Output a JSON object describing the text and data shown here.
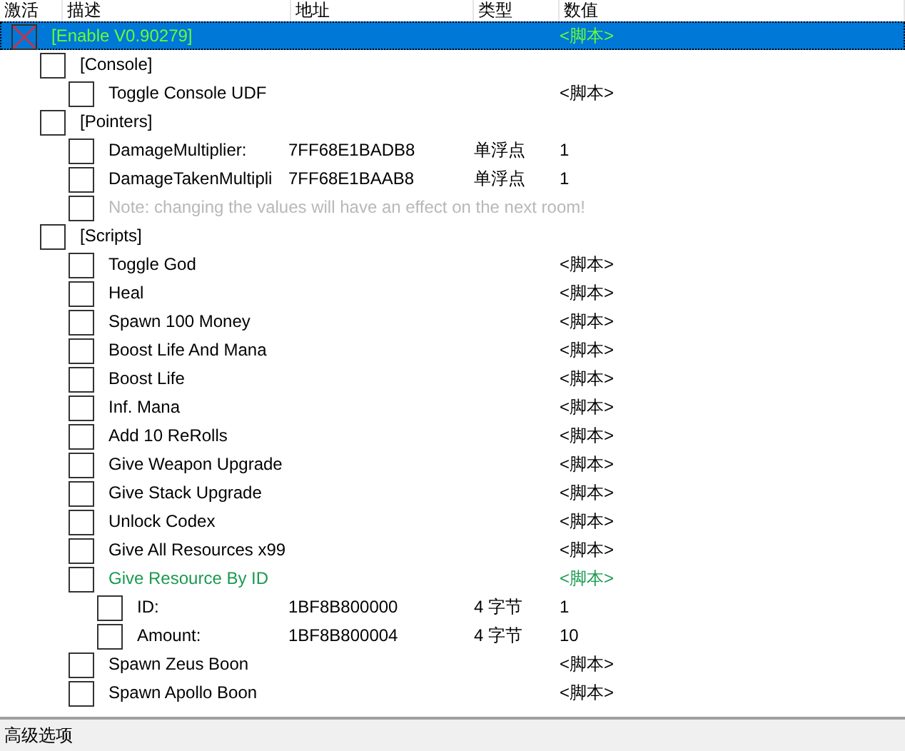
{
  "columns": [
    "激活",
    "描述",
    "地址",
    "类型",
    "数值"
  ],
  "rows": [
    {
      "description": "[Enable V0.90279]",
      "value": "<脚本>",
      "checked": true,
      "selected": true,
      "color": "#66ff33",
      "children": [
        {
          "description": "[Console]",
          "checked": false,
          "selected": false,
          "children": [
            {
              "description": "Toggle Console UDF",
              "value": "<脚本>",
              "checked": false,
              "selected": false
            }
          ]
        },
        {
          "description": "[Pointers]",
          "checked": false,
          "selected": false,
          "children": [
            {
              "description": "DamageMultiplier:",
              "address": "7FF68E1BADB8",
              "type": "单浮点",
              "value": "1",
              "checked": false,
              "selected": false
            },
            {
              "description": "DamageTakenMultipli",
              "address": "7FF68E1BAAB8",
              "type": "单浮点",
              "value": "1",
              "checked": false,
              "selected": false
            },
            {
              "description": "Note: changing the values will have an effect on the next room!",
              "kind": "note",
              "checked": false,
              "selected": false
            }
          ]
        },
        {
          "description": "[Scripts]",
          "checked": false,
          "selected": false,
          "children": [
            {
              "description": "Toggle God",
              "value": "<脚本>",
              "checked": false,
              "selected": false
            },
            {
              "description": "Heal",
              "value": "<脚本>",
              "checked": false,
              "selected": false
            },
            {
              "description": "Spawn 100 Money",
              "value": "<脚本>",
              "checked": false,
              "selected": false
            },
            {
              "description": "Boost Life And Mana",
              "value": "<脚本>",
              "checked": false,
              "selected": false
            },
            {
              "description": "Boost Life",
              "value": "<脚本>",
              "checked": false,
              "selected": false
            },
            {
              "description": "Inf. Mana",
              "value": "<脚本>",
              "checked": false,
              "selected": false
            },
            {
              "description": "Add 10 ReRolls",
              "value": "<脚本>",
              "checked": false,
              "selected": false
            },
            {
              "description": "Give Weapon Upgrade",
              "value": "<脚本>",
              "checked": false,
              "selected": false
            },
            {
              "description": "Give Stack Upgrade",
              "value": "<脚本>",
              "checked": false,
              "selected": false
            },
            {
              "description": "Unlock Codex",
              "value": "<脚本>",
              "checked": false,
              "selected": false
            },
            {
              "description": "Give All Resources x99",
              "value": "<脚本>",
              "checked": false,
              "selected": false
            },
            {
              "description": "Give Resource By ID",
              "value": "<脚本>",
              "checked": false,
              "selected": false,
              "color": "#1a9a50",
              "children": [
                {
                  "description": "ID:",
                  "address": "1BF8B800000",
                  "type": "4 字节",
                  "value": "1",
                  "checked": false,
                  "selected": false
                },
                {
                  "description": "Amount:",
                  "address": "1BF8B800004",
                  "type": "4 字节",
                  "value": "10",
                  "checked": false,
                  "selected": false
                }
              ]
            },
            {
              "description": "Spawn Zeus Boon",
              "value": "<脚本>",
              "checked": false,
              "selected": false
            },
            {
              "description": "Spawn Apollo Boon",
              "value": "<脚本>",
              "checked": false,
              "selected": false
            }
          ]
        }
      ]
    }
  ],
  "footer": "高级选项"
}
